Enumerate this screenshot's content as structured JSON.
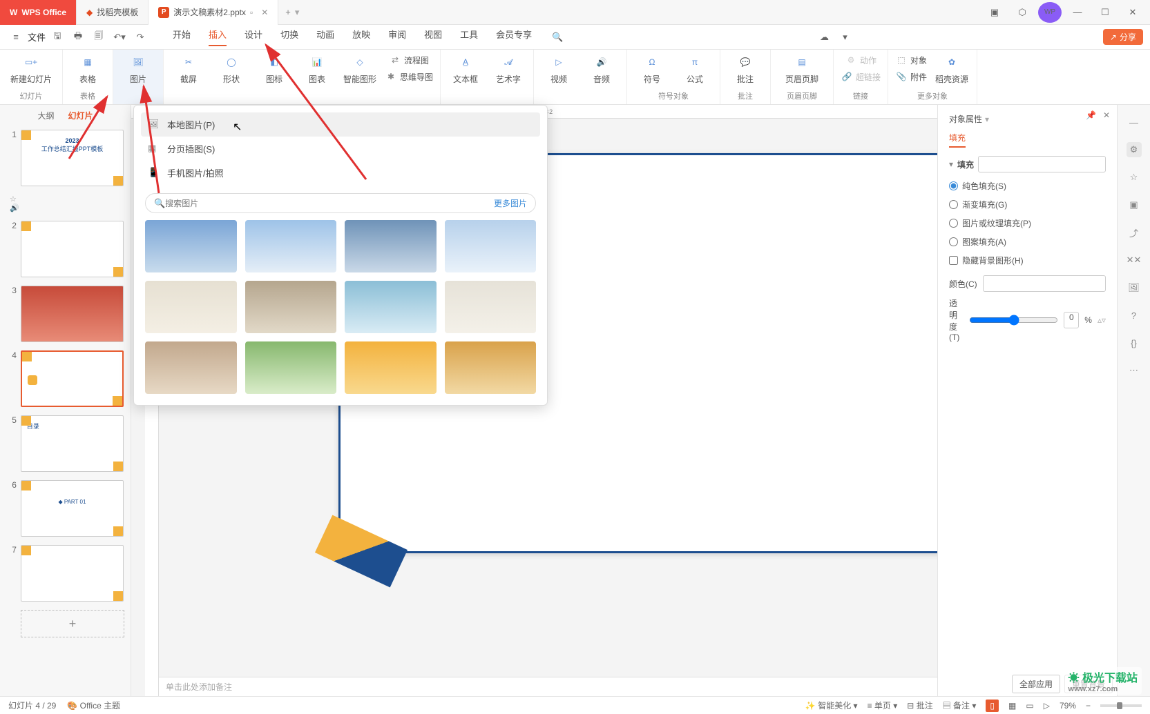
{
  "titlebar": {
    "app": "WPS Office",
    "tab_template": "找稻壳模板",
    "tab_active": "演示文稿素材2.pptx",
    "new_tab": "+"
  },
  "menubar": {
    "file": "文件",
    "items": [
      "开始",
      "插入",
      "设计",
      "切换",
      "动画",
      "放映",
      "审阅",
      "视图",
      "工具",
      "会员专享"
    ],
    "share": "分享"
  },
  "ribbon": {
    "group1_label": "幻灯片",
    "new_slide": "新建幻灯片",
    "group2_label": "表格",
    "table": "表格",
    "group3": "图片",
    "screenshot": "截屏",
    "shapes": "形状",
    "icons": "图标",
    "chart": "图表",
    "smartart": "智能图形",
    "g3a": "流程图",
    "g3b": "思维导图",
    "textbox": "文本框",
    "wordart": "艺术字",
    "video": "视频",
    "audio": "音频",
    "symbol": "符号",
    "formula": "公式",
    "symlabel": "符号对象",
    "comment": "批注",
    "comlabel": "批注",
    "headerfooter": "页眉页脚",
    "hflabel": "页眉页脚",
    "action": "动作",
    "hyperlink": "超链接",
    "linklabel": "链接",
    "object": "对象",
    "attachment": "附件",
    "resources": "稻壳资源",
    "morelabel": "更多对象"
  },
  "sidepanel": {
    "tab_outline": "大纲",
    "tab_slides": "幻灯片",
    "t1_a": "2023",
    "t1_b": "工作总结汇报PPT模板",
    "t5": "目录",
    "t6": "PART 01"
  },
  "popup": {
    "local": "本地图片(P)",
    "paged": "分页插图(S)",
    "phone": "手机图片/拍照",
    "search_placeholder": "搜索图片",
    "more": "更多图片"
  },
  "proppanel": {
    "title": "对象属性",
    "tab": "填充",
    "section": "填充",
    "r1": "纯色填充(S)",
    "r2": "渐变填充(G)",
    "r3": "图片或纹理填充(P)",
    "r4": "图案填充(A)",
    "chk": "隐藏背景图形(H)",
    "color": "颜色(C)",
    "opacity": "透明度(T)",
    "opval": "0",
    "oppct": "%",
    "apply_all": "全部应用",
    "reset": "重置背景"
  },
  "notes": {
    "placeholder": "单击此处添加备注"
  },
  "status": {
    "slide": "幻灯片 4 / 29",
    "theme": "Office 主题",
    "beautify": "智能美化",
    "singlepage": "单页",
    "comments": "批注",
    "notes": "备注",
    "zoom": "79%"
  },
  "watermark": {
    "name": "极光下载站",
    "url": "www.xz7.com"
  }
}
